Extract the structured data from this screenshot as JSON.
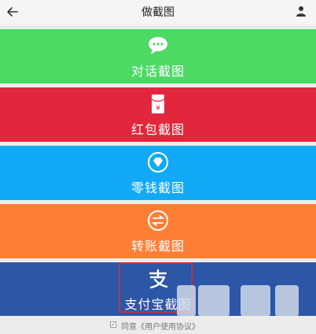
{
  "header": {
    "title": "做截图",
    "back_icon": "back-arrow-icon",
    "user_icon": "user-icon"
  },
  "tiles": [
    {
      "label": "对话截图",
      "color": "#4cd964",
      "icon": "chat-bubble-icon"
    },
    {
      "label": "红包截图",
      "color": "#e2273d",
      "icon": "red-envelope-icon"
    },
    {
      "label": "零钱截图",
      "color": "#12aaf6",
      "icon": "diamond-icon"
    },
    {
      "label": "转账截图",
      "color": "#ff7e35",
      "icon": "transfer-icon"
    },
    {
      "label": "支付宝截图",
      "color": "#2c56a6",
      "icon": "alipay-icon"
    }
  ],
  "footer": {
    "agree_check": "✓",
    "agree_text": "同意《用户使用协议》"
  },
  "colors": {
    "highlight_border": "#d52a2a",
    "header_bg": "#f5f5f5"
  }
}
